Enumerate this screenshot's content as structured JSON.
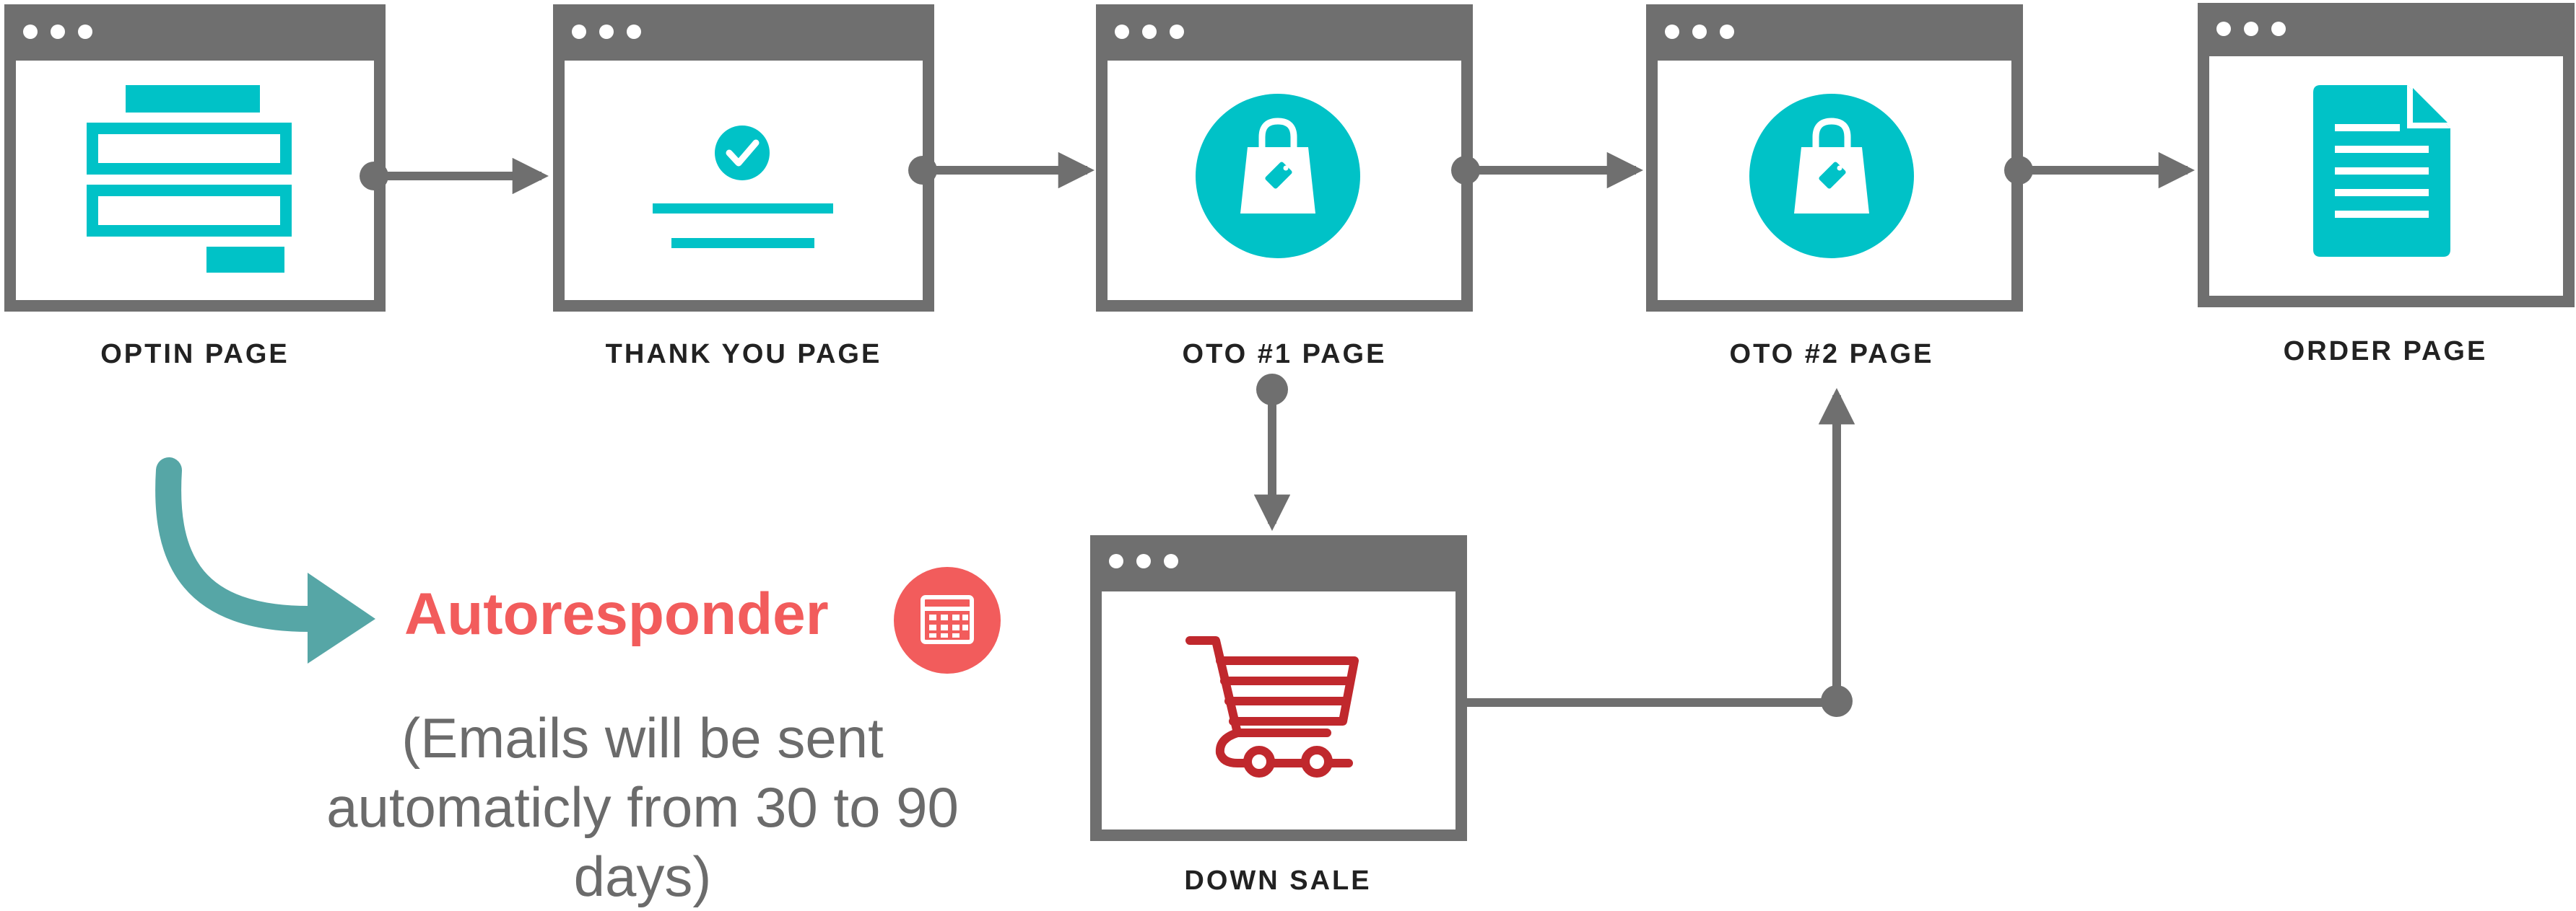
{
  "windows": [
    {
      "id": "optin",
      "label": "OPTIN PAGE",
      "icon": "form-icon"
    },
    {
      "id": "thankyou",
      "label": "THANK YOU PAGE",
      "icon": "check-icon"
    },
    {
      "id": "oto1",
      "label": "OTO #1 PAGE",
      "icon": "shopping-bag-icon"
    },
    {
      "id": "oto2",
      "label": "OTO #2 PAGE",
      "icon": "shopping-bag-icon"
    },
    {
      "id": "order",
      "label": "ORDER PAGE",
      "icon": "document-icon"
    },
    {
      "id": "downsale",
      "label": "DOWN SALE",
      "icon": "shopping-cart-icon"
    }
  ],
  "autoresponder": {
    "title": "Autoresponder",
    "icon": "calendar-icon",
    "description": "(Emails will be sent automaticly from 30 to 90 days)"
  },
  "colors": {
    "frame": "#6f6f6f",
    "accent": "#00c2c7",
    "autoresponder": "#f25c5c",
    "cart": "#c0282d",
    "curve_arrow": "#56a6a6",
    "text": "#222222"
  }
}
